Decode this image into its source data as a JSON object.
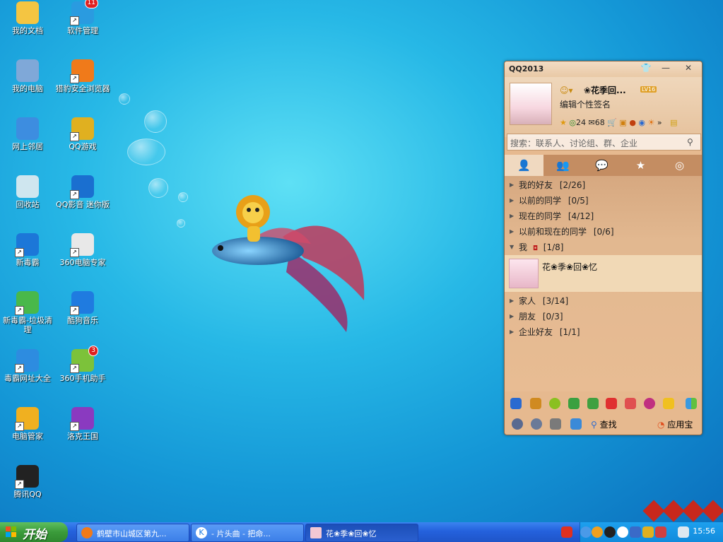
{
  "desktop": {
    "icons": [
      {
        "label": "我的文档",
        "icon": "folder-documents-icon",
        "color": "#f4c542",
        "shortcut": false
      },
      {
        "label": "软件管理",
        "icon": "software-manager-icon",
        "color": "#2a9be0",
        "shortcut": true,
        "badge": "11"
      },
      {
        "label": "我的电脑",
        "icon": "computer-icon",
        "color": "#7fa8d8",
        "shortcut": false
      },
      {
        "label": "猎豹安全浏览器",
        "icon": "cheetah-browser-icon",
        "color": "#f07a1a",
        "shortcut": true
      },
      {
        "label": "网上邻居",
        "icon": "network-icon",
        "color": "#3d8de0",
        "shortcut": false
      },
      {
        "label": "QQ游戏",
        "icon": "qq-game-icon",
        "color": "#e0b020",
        "shortcut": true
      },
      {
        "label": "回收站",
        "icon": "recycle-bin-icon",
        "color": "#cfe6ef",
        "shortcut": false
      },
      {
        "label": "QQ影音 迷你版",
        "icon": "qq-player-icon",
        "color": "#1a6fd0",
        "shortcut": true
      },
      {
        "label": "新毒霸",
        "icon": "duba-icon",
        "color": "#1c77d8",
        "shortcut": true
      },
      {
        "label": "360电脑专家",
        "icon": "doctor-icon",
        "color": "#e8e8e8",
        "shortcut": true
      },
      {
        "label": "新毒霸-垃圾清理",
        "icon": "trash-clean-icon",
        "color": "#49b84a",
        "shortcut": true
      },
      {
        "label": "酷狗音乐",
        "icon": "kugou-icon",
        "color": "#1f7be0",
        "shortcut": true
      },
      {
        "label": "毒霸网址大全",
        "icon": "ie-icon",
        "color": "#2d8ce0",
        "shortcut": true
      },
      {
        "label": "360手机助手",
        "icon": "phone-assistant-icon",
        "color": "#7cc23a",
        "shortcut": true,
        "badge": "3"
      },
      {
        "label": "电脑管家",
        "icon": "pc-manager-icon",
        "color": "#f0b020",
        "shortcut": true
      },
      {
        "label": "洛克王国",
        "icon": "roco-kingdom-icon",
        "color": "#8a3ac0",
        "shortcut": true
      },
      {
        "label": "腾讯QQ",
        "icon": "qq-penguin-icon",
        "color": "#222222",
        "shortcut": true
      }
    ]
  },
  "qq": {
    "title": "QQ2013",
    "nickname": "❀花季回...",
    "level_badge": "LV16",
    "signature": "编辑个性签名",
    "counts": {
      "zone": "24",
      "mail": "68"
    },
    "search_placeholder": "搜索：联系人、讨论组、群、企业",
    "tabs": [
      "contacts",
      "groups",
      "recent",
      "favorites",
      "zone"
    ],
    "groups_top": [
      {
        "label": "我的好友",
        "count": "[2/26]"
      },
      {
        "label": "以前的同学",
        "count": "[0/5]"
      },
      {
        "label": "现在的同学",
        "count": "[4/12]"
      },
      {
        "label": "以前和现在的同学",
        "count": "[0/6]"
      }
    ],
    "me_group": {
      "label": "我",
      "count": "[1/8]"
    },
    "contact": {
      "name": "花❀季❀回❀忆"
    },
    "groups_bottom": [
      {
        "label": "家人",
        "count": "[3/14]"
      },
      {
        "label": "朋友",
        "count": "[0/3]"
      },
      {
        "label": "企业好友",
        "count": "[1/1]"
      }
    ],
    "bottom": {
      "find_label": "查找",
      "appbox_label": "应用宝"
    }
  },
  "taskbar": {
    "start_label": "开始",
    "tasks": [
      {
        "label": "鹤壁市山城区第九...",
        "active": false
      },
      {
        "label": "- 片头曲 - 把命...",
        "active": false
      },
      {
        "label": "花❀季❀回❀忆",
        "active": true
      }
    ],
    "clock": "15:56"
  },
  "colors": {
    "accent": "#2461dd",
    "qq_panel": "#e6b98f"
  }
}
